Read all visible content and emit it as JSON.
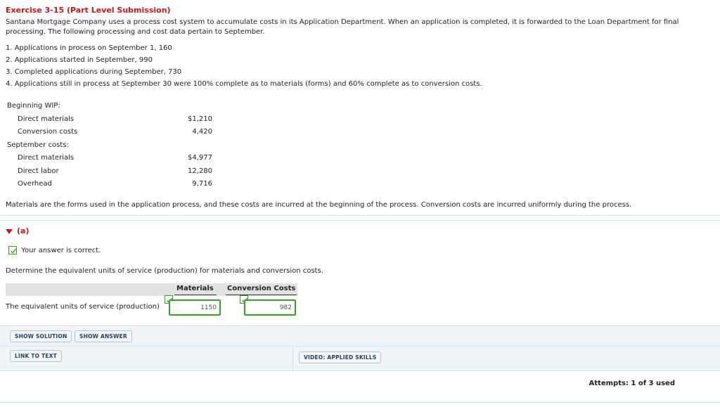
{
  "exercise": {
    "title": "Exercise 3-15 (Part Level Submission)",
    "intro": "Santana Mortgage Company uses a process cost system to accumulate costs in its Application Department. When an application is completed, it is forwarded to the Loan Department for final processing. The following processing and cost data pertain to September.",
    "items": [
      "1.  Applications in process on September 1, 160",
      "2.  Applications started in September, 990",
      "3.  Completed applications during September, 730",
      "4.  Applications still in process at September 30 were 100% complete as to materials (forms) and 60% complete as to conversion costs."
    ]
  },
  "costs": {
    "beginning_wip_heading": "Beginning WIP:",
    "beginning_wip": [
      {
        "label": "Direct materials",
        "value": "$1,210"
      },
      {
        "label": "Conversion costs",
        "value": "4,420"
      }
    ],
    "september_heading": "September costs:",
    "september": [
      {
        "label": "Direct materials",
        "value": "$4,977"
      },
      {
        "label": "Direct labor",
        "value": "12,280"
      },
      {
        "label": "Overhead",
        "value": "9,716"
      }
    ],
    "note": "Materials are the forms used in the application process, and these costs are incurred at the beginning of the process. Conversion costs are incurred uniformly during the process."
  },
  "part_a": {
    "label": "(a)",
    "feedback": "Your answer is correct.",
    "question": "Determine the equivalent units of service (production) for materials and conversion costs.",
    "table": {
      "col_materials": "Materials",
      "col_conversion": "Conversion Costs",
      "row_label": "The equivalent units of service (production)",
      "materials_value": "1150",
      "conversion_value": "982"
    },
    "buttons": {
      "show_solution": "SHOW SOLUTION",
      "show_answer": "SHOW ANSWER",
      "link_to_text": "LINK TO TEXT",
      "video": "VIDEO: APPLIED SKILLS"
    },
    "attempts": "Attempts: 1 of 3 used"
  },
  "colors": {
    "title_red": "#c2191b",
    "correct_green": "#3c9b2c",
    "button_text": "#23415f"
  },
  "icons": [
    "caret-down-icon",
    "checkmark-icon"
  ]
}
